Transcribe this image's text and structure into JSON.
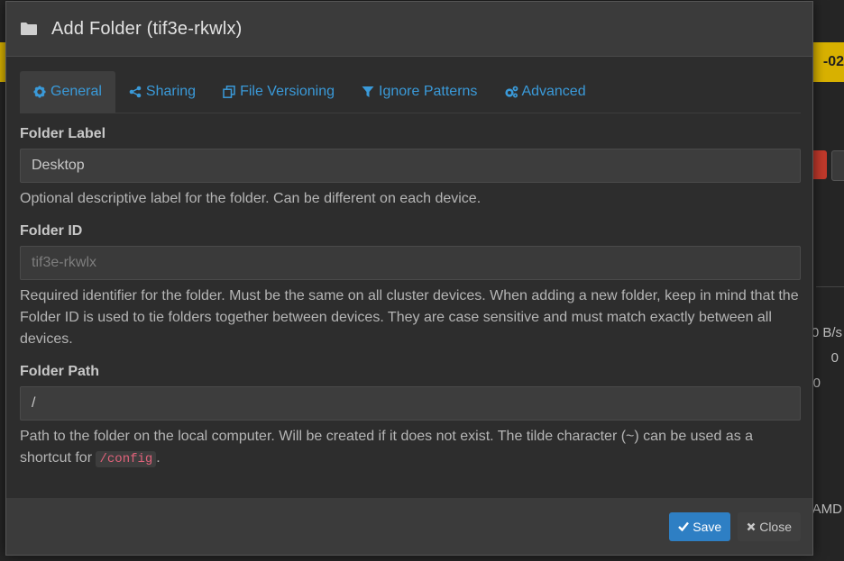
{
  "modal": {
    "title": "Add Folder (tif3e-rkwlx)",
    "tabs": [
      {
        "label": "General",
        "icon": "gear-icon",
        "active": true
      },
      {
        "label": "Sharing",
        "icon": "share-icon"
      },
      {
        "label": "File Versioning",
        "icon": "copy-icon"
      },
      {
        "label": "Ignore Patterns",
        "icon": "filter-icon"
      },
      {
        "label": "Advanced",
        "icon": "gears-icon"
      }
    ],
    "folder_label": {
      "label": "Folder Label",
      "value": "Desktop",
      "help": "Optional descriptive label for the folder. Can be different on each device."
    },
    "folder_id": {
      "label": "Folder ID",
      "value": "tif3e-rkwlx",
      "help": "Required identifier for the folder. Must be the same on all cluster devices. When adding a new folder, keep in mind that the Folder ID is used to tie folders together between devices. They are case sensitive and must match exactly between all devices."
    },
    "folder_path": {
      "label": "Folder Path",
      "value": "/",
      "help_prefix": "Path to the folder on the local computer. Will be created if it does not exist. The tilde character (~) can be used as a shortcut for",
      "help_code": "/config",
      "help_suffix": "."
    },
    "footer": {
      "save_label": "Save",
      "close_label": "Close"
    }
  },
  "background": {
    "strip_text": "-02",
    "side_texts": [
      "0 B/s",
      "0",
      "0"
    ],
    "bottom_text": "AMD",
    "colors": {
      "yellow": "#d8b100",
      "red": "#c0392b",
      "accent": "#3a9ad9",
      "primary": "#2e7fc4"
    }
  }
}
